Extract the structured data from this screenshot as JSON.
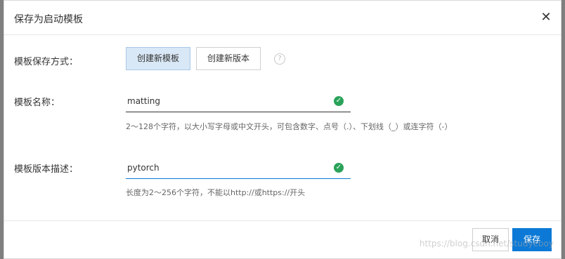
{
  "dialog": {
    "title": "保存为启动模板",
    "close_glyph": "✕"
  },
  "form": {
    "save_mode": {
      "label": "模板保存方式：",
      "options": [
        "创建新模板",
        "创建新版本"
      ],
      "selected": "创建新模板",
      "help_glyph": "?"
    },
    "template_name": {
      "label": "模板名称：",
      "value": "matting",
      "hint": "2～128个字符，以大小写字母或中文开头，可包含数字、点号（.）、下划线（_）或连字符（-）",
      "valid": true
    },
    "version_desc": {
      "label": "模板版本描述：",
      "value": "pytorch",
      "hint": "长度为2～256个字符，不能以http://或https://开头",
      "valid": true
    }
  },
  "footer": {
    "cancel_label": "取消",
    "save_label": "保存"
  },
  "watermark": "https://blog.csdn.net/studyeboy",
  "colors": {
    "primary": "#0c79d6",
    "active_option_bg": "#d9e8f6",
    "valid_green": "#2aa35a",
    "name_underline": "#333333",
    "desc_underline": "#0c79d6"
  },
  "icons": {
    "close": "close-icon",
    "help": "help-icon",
    "valid": "check-circle-icon"
  }
}
